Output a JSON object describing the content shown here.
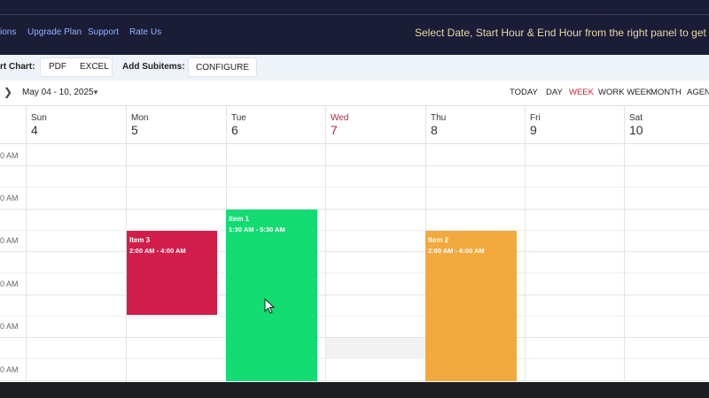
{
  "topbar": {
    "nav": [
      "ions",
      "Upgrade Plan",
      "Support",
      "Rate Us"
    ],
    "message": "Select Date, Start Hour & End Hour from the right panel to get starte"
  },
  "export": {
    "label": "rt Chart:",
    "pdf": "PDF",
    "excel": "EXCEL",
    "subitems_label": "Add Subitems:",
    "configure": "CONFIGURE"
  },
  "toolbar": {
    "prev_icon": "chevron-left-icon",
    "range": "May 04 - 10, 2025",
    "dropdown_icon": "caret-down-icon",
    "today": "TODAY",
    "views": [
      "DAY",
      "WEEK",
      "WORK WEEK",
      "MONTH",
      "AGEND"
    ],
    "active_view": "WEEK"
  },
  "days": [
    {
      "name": "Sun",
      "date": "4"
    },
    {
      "name": "Mon",
      "date": "5"
    },
    {
      "name": "Tue",
      "date": "6"
    },
    {
      "name": "Wed",
      "date": "7"
    },
    {
      "name": "Thu",
      "date": "8"
    },
    {
      "name": "Fri",
      "date": "9"
    },
    {
      "name": "Sat",
      "date": "10"
    }
  ],
  "today_day": "Wed",
  "time_labels": [
    "0 AM",
    "0 AM",
    "0 AM",
    "0 AM",
    "0 AM",
    "0 AM"
  ],
  "events": [
    {
      "title": "Item 3",
      "time": "2:00 AM - 4:00 AM",
      "color": "#d21d4b"
    },
    {
      "title": "Item 1",
      "time": "1:30 AM - 5:30 AM",
      "color": "#12dc72"
    },
    {
      "title": "Item 2",
      "time": "2:00 AM - 6:00 AM",
      "color": "#f2a93f"
    }
  ],
  "colors": {
    "topbar": "#1b1c36",
    "accent_active": "#c0283b",
    "today": "#b0273d"
  }
}
